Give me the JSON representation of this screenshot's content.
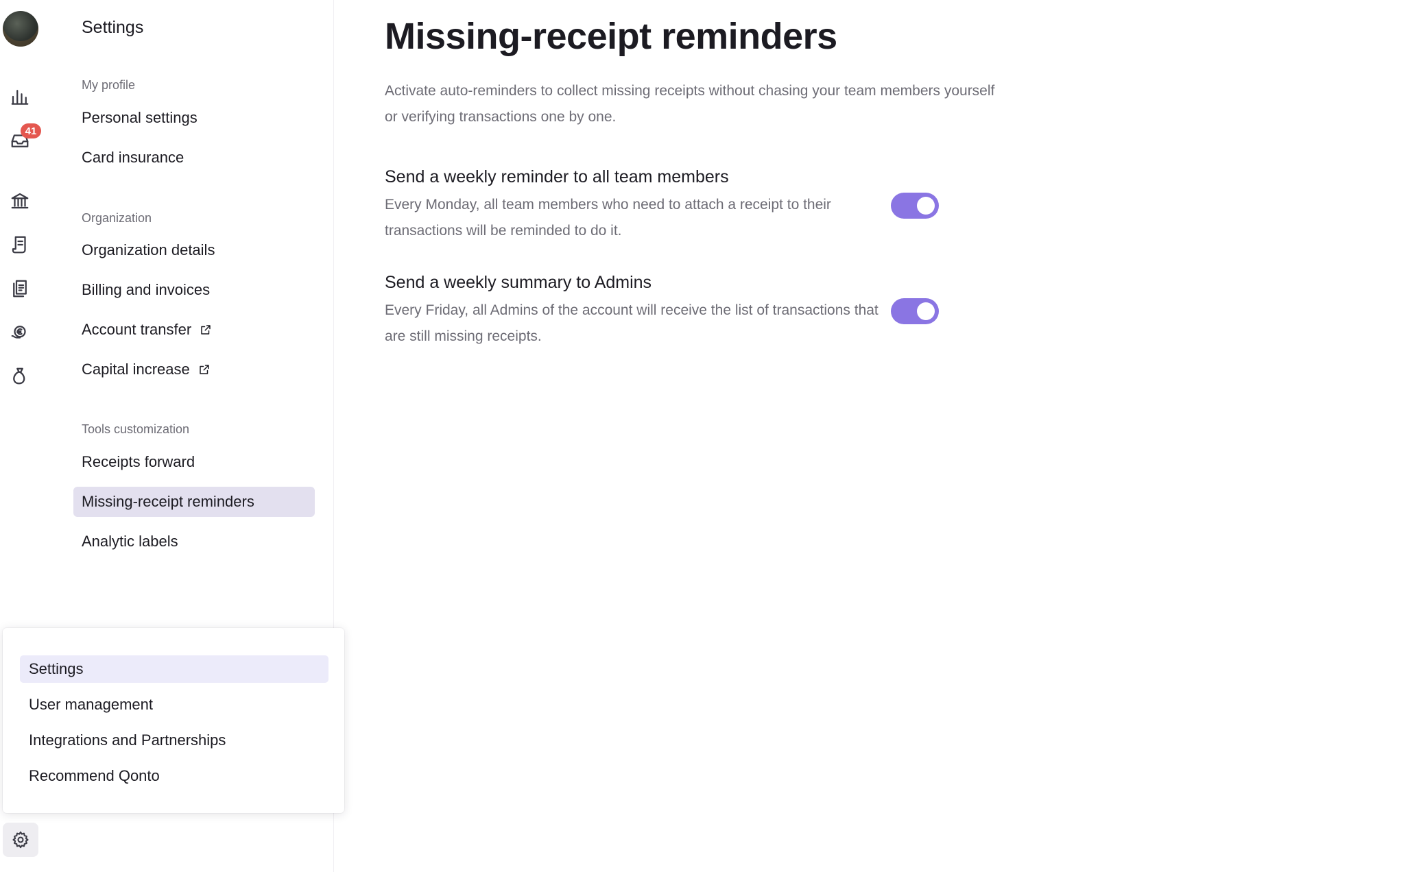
{
  "rail": {
    "notifications_badge": "41",
    "icons": [
      "bar-chart-icon",
      "inbox-icon",
      "bank-icon",
      "receipt-icon",
      "documents-icon",
      "euro-hand-icon",
      "money-bag-icon",
      "gear-icon"
    ]
  },
  "nav": {
    "title": "Settings",
    "sections": {
      "my_profile": "My profile",
      "organization": "Organization",
      "tools": "Tools customization"
    },
    "items": {
      "personal_settings": "Personal settings",
      "card_insurance": "Card insurance",
      "organization_details": "Organization details",
      "billing_invoices": "Billing and invoices",
      "account_transfer": "Account transfer",
      "capital_increase": "Capital increase",
      "receipts_forward": "Receipts forward",
      "missing_receipt_reminders": "Missing-receipt reminders",
      "analytic_labels": "Analytic labels"
    },
    "active": "missing_receipt_reminders"
  },
  "main": {
    "title": "Missing-receipt reminders",
    "intro": "Activate auto-reminders to collect missing receipts without chasing your team members yourself or verifying transactions one by one.",
    "options": [
      {
        "title": "Send a weekly reminder to all team members",
        "description": "Every Monday, all team members who need to attach a receipt to their transactions will be reminded to do it.",
        "enabled": true
      },
      {
        "title": "Send a weekly summary to Admins",
        "description": "Every Friday, all Admins of the account will receive the list of transactions that are still missing receipts.",
        "enabled": true
      }
    ]
  },
  "popover": {
    "items": [
      "Settings",
      "User management",
      "Integrations and Partnerships",
      "Recommend Qonto"
    ],
    "active": "Settings"
  },
  "colors": {
    "accent_toggle": "#8a75e3",
    "nav_active_bg": "#e3e0ef",
    "popover_active_bg": "#ecebfa",
    "badge": "#e4574f"
  }
}
